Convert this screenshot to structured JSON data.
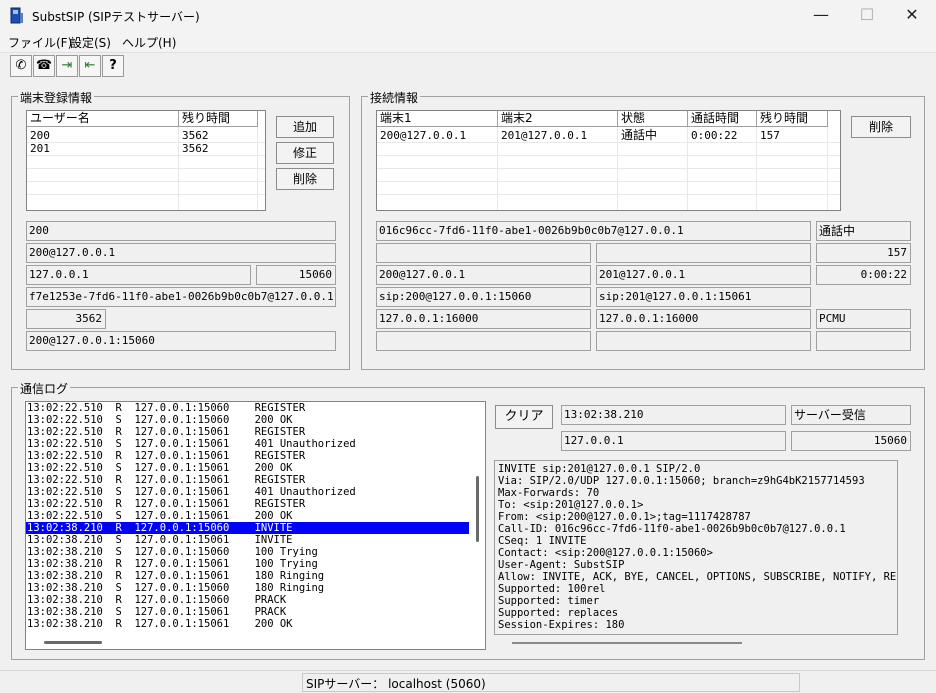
{
  "window": {
    "title": "SubstSIP (SIPテストサーバー)",
    "minimize": "—",
    "maximize": "☐",
    "close": "✕"
  },
  "menu": [
    "ファイル(F)",
    "設定(S)",
    "ヘルプ(H)"
  ],
  "toolbar": {
    "call": "✆",
    "hangup": "☎",
    "export": "⇥",
    "import": "⇤",
    "help": "?"
  },
  "terminal": {
    "group_title": "端末登録情報",
    "columns": [
      "ユーザー名",
      "残り時間"
    ],
    "rows": [
      [
        "200",
        "3562"
      ],
      [
        "201",
        "3562"
      ]
    ],
    "buttons": {
      "add": "追加",
      "edit": "修正",
      "delete": "削除"
    },
    "fields": {
      "user": "200",
      "aor": "200@127.0.0.1",
      "ip": "127.0.0.1",
      "port": "15060",
      "callid": "f7e1253e-7fd6-11f0-abe1-0026b9b0c0b7@127.0.0.1",
      "expires": "3562",
      "contact": "200@127.0.0.1:15060"
    }
  },
  "connection": {
    "group_title": "接続情報",
    "columns": [
      "端末1",
      "端末2",
      "状態",
      "通話時間",
      "残り時間"
    ],
    "rows": [
      [
        "200@127.0.0.1",
        "201@127.0.0.1",
        "通話中",
        "0:00:22",
        "157"
      ]
    ],
    "delete_button": "削除",
    "fields": {
      "callid": "016c96cc-7fd6-11f0-abe1-0026b9b0c0b7@127.0.0.1",
      "state": "通話中",
      "remain": "157",
      "from": "200@127.0.0.1",
      "to": "201@127.0.0.1",
      "duration": "0:00:22",
      "contact1": "sip:200@127.0.0.1:15060",
      "contact2": "sip:201@127.0.0.1:15061",
      "media1": "127.0.0.1:16000",
      "media2": "127.0.0.1:16000",
      "codec": "PCMU"
    }
  },
  "log": {
    "group_title": "通信ログ",
    "clear_button": "クリア",
    "rows": [
      "13:02:22.510  R  127.0.0.1:15060    REGISTER",
      "13:02:22.510  S  127.0.0.1:15060    200 OK",
      "13:02:22.510  R  127.0.0.1:15061    REGISTER",
      "13:02:22.510  S  127.0.0.1:15061    401 Unauthorized",
      "13:02:22.510  R  127.0.0.1:15061    REGISTER",
      "13:02:22.510  S  127.0.0.1:15061    200 OK",
      "13:02:22.510  R  127.0.0.1:15061    REGISTER",
      "13:02:22.510  S  127.0.0.1:15061    401 Unauthorized",
      "13:02:22.510  R  127.0.0.1:15061    REGISTER",
      "13:02:22.510  S  127.0.0.1:15061    200 OK",
      "13:02:38.210  R  127.0.0.1:15060    INVITE",
      "13:02:38.210  S  127.0.0.1:15061    INVITE",
      "13:02:38.210  S  127.0.0.1:15060    100 Trying",
      "13:02:38.210  R  127.0.0.1:15061    100 Trying",
      "13:02:38.210  R  127.0.0.1:15061    180 Ringing",
      "13:02:38.210  S  127.0.0.1:15060    180 Ringing",
      "13:02:38.210  R  127.0.0.1:15060    PRACK",
      "13:02:38.210  S  127.0.0.1:15061    PRACK",
      "13:02:38.210  R  127.0.0.1:15061    200 OK"
    ],
    "detail": {
      "time": "13:02:38.210",
      "direction": "サーバー受信",
      "ip": "127.0.0.1",
      "port": "15060"
    },
    "message": [
      "INVITE sip:201@127.0.0.1 SIP/2.0",
      "Via: SIP/2.0/UDP 127.0.0.1:15060; branch=z9hG4bK2157714593",
      "Max-Forwards: 70",
      "To: <sip:201@127.0.0.1>",
      "From: <sip:200@127.0.0.1>;tag=1117428787",
      "Call-ID: 016c96cc-7fd6-11f0-abe1-0026b9b0c0b7@127.0.0.1",
      "CSeq: 1 INVITE",
      "Contact: <sip:200@127.0.0.1:15060>",
      "User-Agent: SubstSIP",
      "Allow: INVITE, ACK, BYE, CANCEL, OPTIONS, SUBSCRIBE, NOTIFY, REFER",
      "Supported: 100rel",
      "Supported: timer",
      "Supported: replaces",
      "Session-Expires: 180"
    ]
  },
  "statusbar": {
    "text": "SIPサーバー： localhost (5060)"
  }
}
